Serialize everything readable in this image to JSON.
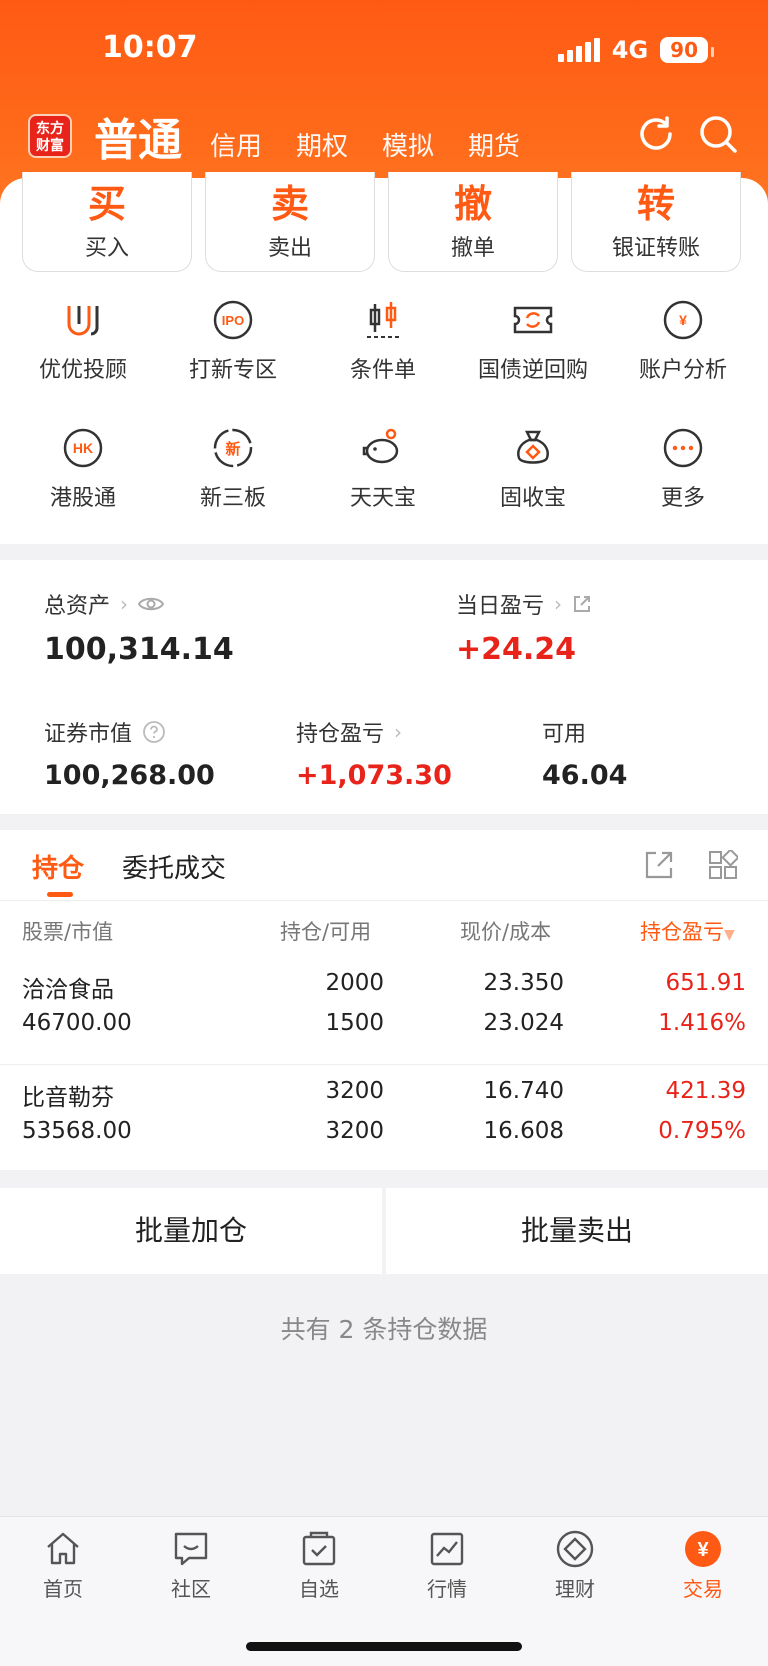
{
  "status": {
    "time": "10:07",
    "network": "4G",
    "battery": "90"
  },
  "header": {
    "logo_text": "东方财富",
    "tabs": [
      "普通",
      "信用",
      "期权",
      "模拟",
      "期货"
    ]
  },
  "quick_actions": [
    {
      "big": "买",
      "label": "买入"
    },
    {
      "big": "卖",
      "label": "卖出"
    },
    {
      "big": "撤",
      "label": "撤单"
    },
    {
      "big": "转",
      "label": "银证转账"
    }
  ],
  "grid_row1": [
    "优优投顾",
    "打新专区",
    "条件单",
    "国债逆回购",
    "账户分析"
  ],
  "grid_row2": [
    "港股通",
    "新三板",
    "天天宝",
    "固收宝",
    "更多"
  ],
  "grid_badges": {
    "ipo": "IPO",
    "hk": "HK",
    "new": "新",
    "cny": "¥"
  },
  "assets": {
    "total_label": "总资产",
    "total_value": "100,314.14",
    "daily_label": "当日盈亏",
    "daily_value": "+24.24",
    "market_label": "证券市值",
    "market_value": "100,268.00",
    "holding_pl_label": "持仓盈亏",
    "holding_pl_value": "+1,073.30",
    "available_label": "可用",
    "available_value": "46.04"
  },
  "positions": {
    "tabs": [
      "持仓",
      "委托成交"
    ],
    "columns": [
      "股票/市值",
      "持仓/可用",
      "现价/成本",
      "持仓盈亏"
    ],
    "rows": [
      {
        "name": "洽洽食品",
        "market_value": "46700.00",
        "holding": "2000",
        "available": "1500",
        "price": "23.350",
        "cost": "23.024",
        "pl": "651.91",
        "pl_pct": "1.416%"
      },
      {
        "name": "比音勒芬",
        "market_value": "53568.00",
        "holding": "3200",
        "available": "3200",
        "price": "16.740",
        "cost": "16.608",
        "pl": "421.39",
        "pl_pct": "0.795%"
      }
    ]
  },
  "batch": {
    "add": "批量加仓",
    "sell": "批量卖出"
  },
  "footer_note": "共有 2 条持仓数据",
  "nav": [
    {
      "label": "首页",
      "icon": "home-icon"
    },
    {
      "label": "社区",
      "icon": "chat-icon"
    },
    {
      "label": "自选",
      "icon": "checkbox-icon"
    },
    {
      "label": "行情",
      "icon": "chart-icon"
    },
    {
      "label": "理财",
      "icon": "diamond-icon"
    },
    {
      "label": "交易",
      "icon": "yuan-icon"
    }
  ],
  "colors": {
    "accent": "#ff5a14",
    "red": "#e8231a"
  }
}
